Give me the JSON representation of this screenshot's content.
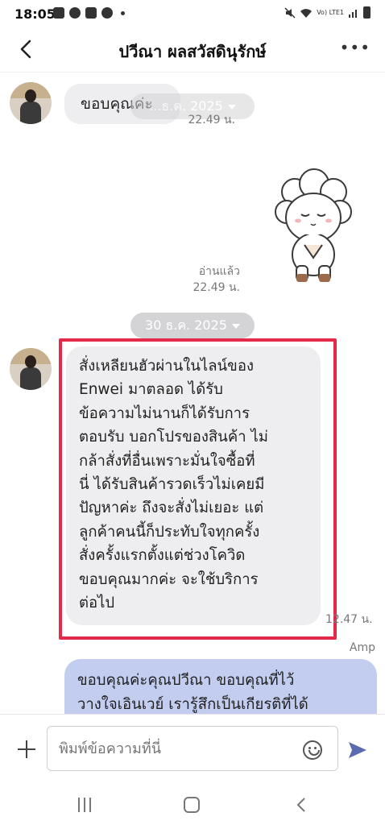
{
  "status_bar": {
    "time": "18:05",
    "network": "Vo) LTE1"
  },
  "header": {
    "title": "ปวีณา ผลสวัสดินุรักษ์"
  },
  "chat": {
    "message_1": {
      "text": "ขอบคุณค่ะ"
    },
    "date_pill_top": {
      "label": "...ธ.ค. 2025"
    },
    "time_1": "22.49 น.",
    "sticker": {
      "name": "sheep-bowing-sticker"
    },
    "read_receipt": "อ่านแล้ว",
    "time_2": "22.49 น.",
    "date_pill": {
      "label": "30 ธ.ค. 2025"
    },
    "message_2": {
      "lines": [
        "สั่งเหลียนฮัวผ่านในไลน์ของ",
        "Enwei มาตลอด ได้รับ",
        "ข้อความไม่นานก็ได้รับการ",
        "ตอบรับ บอกโปรของสินค้า ไม่",
        "กล้าสั่งที่อื่นเพราะมั่นใจซื้อที่",
        "นี่ ได้รับสินค้ารวดเร็วไม่เคยมี",
        "ปัญหาค่ะ ถึงจะสั่งไม่เยอะ แต่",
        "ลูกค้าคนนี้ก็ประทับใจทุกครั้ง",
        "สั่งครั้งแรกตั้งแต่ช่วงโควิด",
        "ขอบคุณมากค่ะ จะใช้บริการ",
        "ต่อไป"
      ]
    },
    "time_3": "12.47 น.",
    "sender_name": "Amp",
    "message_3": {
      "lines": [
        "ขอบคุณค่ะคุณปวีณา ขอบคุณที่ไว้",
        "วางใจเอินเวย์ เรารู้สึกเป็นเกียรติที่ได้"
      ]
    }
  },
  "input": {
    "placeholder": "พิมพ์ข้อความที่นี่"
  },
  "colors": {
    "highlight": "#e5294a",
    "outgoing_bubble": "#c3cdf0",
    "incoming_bubble": "#eeeef0"
  }
}
